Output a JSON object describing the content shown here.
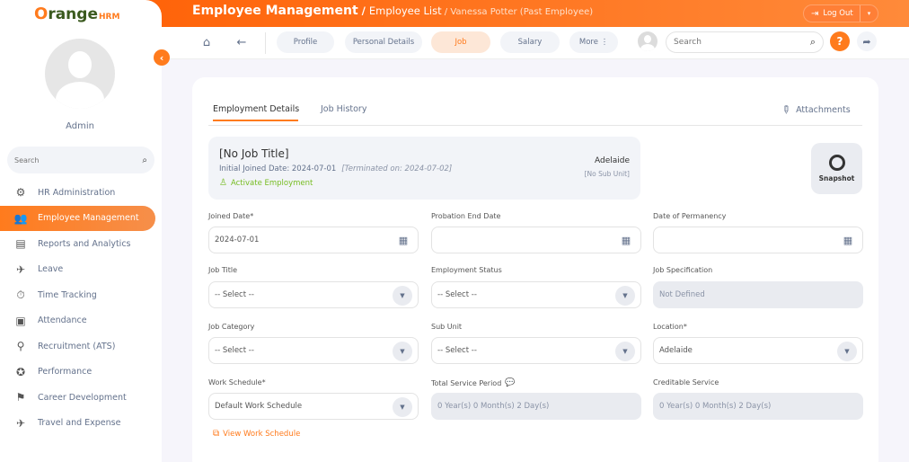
{
  "brand": {
    "o": "O",
    "range": "range",
    "hrm": "HRM"
  },
  "header": {
    "title": "Employee Management",
    "separator": " / ",
    "section": "Employee List",
    "separator2": " / ",
    "employee": "Vanessa Potter (Past Employee)",
    "logout": "Log Out",
    "logout_icon": "logout-icon",
    "caret": "▾"
  },
  "sidebar": {
    "user_name": "Admin",
    "search_placeholder": "Search",
    "items": [
      {
        "label": "HR Administration",
        "icon": "hr-admin-icon"
      },
      {
        "label": "Employee Management",
        "icon": "employee-icon"
      },
      {
        "label": "Reports and Analytics",
        "icon": "reports-icon"
      },
      {
        "label": "Leave",
        "icon": "leave-icon"
      },
      {
        "label": "Time Tracking",
        "icon": "time-icon"
      },
      {
        "label": "Attendance",
        "icon": "attendance-icon"
      },
      {
        "label": "Recruitment (ATS)",
        "icon": "recruitment-icon"
      },
      {
        "label": "Performance",
        "icon": "performance-icon"
      },
      {
        "label": "Career Development",
        "icon": "career-icon"
      },
      {
        "label": "Travel and Expense",
        "icon": "travel-icon"
      }
    ]
  },
  "nav": {
    "tabs": [
      {
        "label": "Profile"
      },
      {
        "label": "Personal Details"
      },
      {
        "label": "Job"
      },
      {
        "label": "Salary"
      },
      {
        "label": "More ⋮"
      }
    ],
    "search_placeholder": "Search"
  },
  "content": {
    "tabs": [
      "Employment Details",
      "Job History"
    ],
    "attachments": "Attachments",
    "summary": {
      "title": "[No Job Title]",
      "initial_joined": "Initial Joined Date: 2024-07-01",
      "terminated": "[Terminated on: 2024-07-02]",
      "activate": "Activate Employment",
      "location": "Adelaide",
      "sub_unit": "[No Sub Unit]"
    },
    "snapshot": "Snapshot",
    "fields": {
      "joined_date": {
        "label": "Joined Date*",
        "value": "2024-07-01"
      },
      "probation_end": {
        "label": "Probation End Date",
        "value": ""
      },
      "date_permanency": {
        "label": "Date of Permanency",
        "value": ""
      },
      "job_title": {
        "label": "Job Title",
        "value": "-- Select --"
      },
      "employment_status": {
        "label": "Employment Status",
        "value": "-- Select --"
      },
      "job_specification": {
        "label": "Job Specification",
        "value": "Not Defined"
      },
      "job_category": {
        "label": "Job Category",
        "value": "-- Select --"
      },
      "sub_unit": {
        "label": "Sub Unit",
        "value": "-- Select --"
      },
      "location": {
        "label": "Location*",
        "value": "Adelaide"
      },
      "work_schedule": {
        "label": "Work Schedule*",
        "value": "Default Work Schedule"
      },
      "total_service": {
        "label": "Total Service Period",
        "value": "0 Year(s) 0 Month(s) 2 Day(s)"
      },
      "creditable_service": {
        "label": "Creditable Service",
        "value": "0 Year(s) 0 Month(s) 2 Day(s)"
      }
    },
    "view_work_schedule": "View Work Schedule"
  },
  "colors": {
    "accent": "#ff7b1d",
    "success": "#76bc21"
  }
}
